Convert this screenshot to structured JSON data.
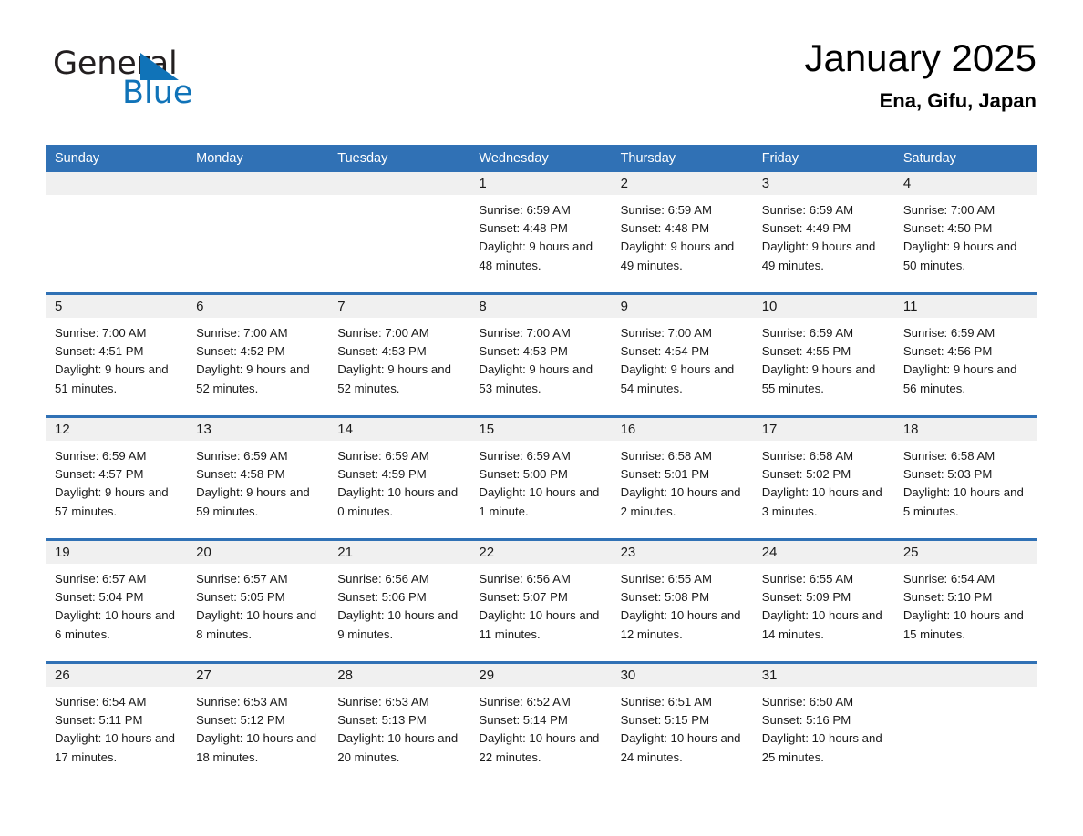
{
  "brand": {
    "name_part1": "General",
    "name_part2": "Blue",
    "triangle_color": "#1073b8",
    "text_color": "#231f20"
  },
  "header": {
    "title": "January 2025",
    "location": "Ena, Gifu, Japan"
  },
  "theme": {
    "header_blue": "#3071b5",
    "daynum_band": "#f0f0f0",
    "page_background": "#ffffff",
    "text": "#1a1a1a"
  },
  "calendar": {
    "weekday_headers": [
      "Sunday",
      "Monday",
      "Tuesday",
      "Wednesday",
      "Thursday",
      "Friday",
      "Saturday"
    ],
    "weeks": [
      [
        {
          "day": "",
          "sunrise": "",
          "sunset": "",
          "daylight": ""
        },
        {
          "day": "",
          "sunrise": "",
          "sunset": "",
          "daylight": ""
        },
        {
          "day": "",
          "sunrise": "",
          "sunset": "",
          "daylight": ""
        },
        {
          "day": "1",
          "sunrise": "Sunrise: 6:59 AM",
          "sunset": "Sunset: 4:48 PM",
          "daylight": "Daylight: 9 hours and 48 minutes."
        },
        {
          "day": "2",
          "sunrise": "Sunrise: 6:59 AM",
          "sunset": "Sunset: 4:48 PM",
          "daylight": "Daylight: 9 hours and 49 minutes."
        },
        {
          "day": "3",
          "sunrise": "Sunrise: 6:59 AM",
          "sunset": "Sunset: 4:49 PM",
          "daylight": "Daylight: 9 hours and 49 minutes."
        },
        {
          "day": "4",
          "sunrise": "Sunrise: 7:00 AM",
          "sunset": "Sunset: 4:50 PM",
          "daylight": "Daylight: 9 hours and 50 minutes."
        }
      ],
      [
        {
          "day": "5",
          "sunrise": "Sunrise: 7:00 AM",
          "sunset": "Sunset: 4:51 PM",
          "daylight": "Daylight: 9 hours and 51 minutes."
        },
        {
          "day": "6",
          "sunrise": "Sunrise: 7:00 AM",
          "sunset": "Sunset: 4:52 PM",
          "daylight": "Daylight: 9 hours and 52 minutes."
        },
        {
          "day": "7",
          "sunrise": "Sunrise: 7:00 AM",
          "sunset": "Sunset: 4:53 PM",
          "daylight": "Daylight: 9 hours and 52 minutes."
        },
        {
          "day": "8",
          "sunrise": "Sunrise: 7:00 AM",
          "sunset": "Sunset: 4:53 PM",
          "daylight": "Daylight: 9 hours and 53 minutes."
        },
        {
          "day": "9",
          "sunrise": "Sunrise: 7:00 AM",
          "sunset": "Sunset: 4:54 PM",
          "daylight": "Daylight: 9 hours and 54 minutes."
        },
        {
          "day": "10",
          "sunrise": "Sunrise: 6:59 AM",
          "sunset": "Sunset: 4:55 PM",
          "daylight": "Daylight: 9 hours and 55 minutes."
        },
        {
          "day": "11",
          "sunrise": "Sunrise: 6:59 AM",
          "sunset": "Sunset: 4:56 PM",
          "daylight": "Daylight: 9 hours and 56 minutes."
        }
      ],
      [
        {
          "day": "12",
          "sunrise": "Sunrise: 6:59 AM",
          "sunset": "Sunset: 4:57 PM",
          "daylight": "Daylight: 9 hours and 57 minutes."
        },
        {
          "day": "13",
          "sunrise": "Sunrise: 6:59 AM",
          "sunset": "Sunset: 4:58 PM",
          "daylight": "Daylight: 9 hours and 59 minutes."
        },
        {
          "day": "14",
          "sunrise": "Sunrise: 6:59 AM",
          "sunset": "Sunset: 4:59 PM",
          "daylight": "Daylight: 10 hours and 0 minutes."
        },
        {
          "day": "15",
          "sunrise": "Sunrise: 6:59 AM",
          "sunset": "Sunset: 5:00 PM",
          "daylight": "Daylight: 10 hours and 1 minute."
        },
        {
          "day": "16",
          "sunrise": "Sunrise: 6:58 AM",
          "sunset": "Sunset: 5:01 PM",
          "daylight": "Daylight: 10 hours and 2 minutes."
        },
        {
          "day": "17",
          "sunrise": "Sunrise: 6:58 AM",
          "sunset": "Sunset: 5:02 PM",
          "daylight": "Daylight: 10 hours and 3 minutes."
        },
        {
          "day": "18",
          "sunrise": "Sunrise: 6:58 AM",
          "sunset": "Sunset: 5:03 PM",
          "daylight": "Daylight: 10 hours and 5 minutes."
        }
      ],
      [
        {
          "day": "19",
          "sunrise": "Sunrise: 6:57 AM",
          "sunset": "Sunset: 5:04 PM",
          "daylight": "Daylight: 10 hours and 6 minutes."
        },
        {
          "day": "20",
          "sunrise": "Sunrise: 6:57 AM",
          "sunset": "Sunset: 5:05 PM",
          "daylight": "Daylight: 10 hours and 8 minutes."
        },
        {
          "day": "21",
          "sunrise": "Sunrise: 6:56 AM",
          "sunset": "Sunset: 5:06 PM",
          "daylight": "Daylight: 10 hours and 9 minutes."
        },
        {
          "day": "22",
          "sunrise": "Sunrise: 6:56 AM",
          "sunset": "Sunset: 5:07 PM",
          "daylight": "Daylight: 10 hours and 11 minutes."
        },
        {
          "day": "23",
          "sunrise": "Sunrise: 6:55 AM",
          "sunset": "Sunset: 5:08 PM",
          "daylight": "Daylight: 10 hours and 12 minutes."
        },
        {
          "day": "24",
          "sunrise": "Sunrise: 6:55 AM",
          "sunset": "Sunset: 5:09 PM",
          "daylight": "Daylight: 10 hours and 14 minutes."
        },
        {
          "day": "25",
          "sunrise": "Sunrise: 6:54 AM",
          "sunset": "Sunset: 5:10 PM",
          "daylight": "Daylight: 10 hours and 15 minutes."
        }
      ],
      [
        {
          "day": "26",
          "sunrise": "Sunrise: 6:54 AM",
          "sunset": "Sunset: 5:11 PM",
          "daylight": "Daylight: 10 hours and 17 minutes."
        },
        {
          "day": "27",
          "sunrise": "Sunrise: 6:53 AM",
          "sunset": "Sunset: 5:12 PM",
          "daylight": "Daylight: 10 hours and 18 minutes."
        },
        {
          "day": "28",
          "sunrise": "Sunrise: 6:53 AM",
          "sunset": "Sunset: 5:13 PM",
          "daylight": "Daylight: 10 hours and 20 minutes."
        },
        {
          "day": "29",
          "sunrise": "Sunrise: 6:52 AM",
          "sunset": "Sunset: 5:14 PM",
          "daylight": "Daylight: 10 hours and 22 minutes."
        },
        {
          "day": "30",
          "sunrise": "Sunrise: 6:51 AM",
          "sunset": "Sunset: 5:15 PM",
          "daylight": "Daylight: 10 hours and 24 minutes."
        },
        {
          "day": "31",
          "sunrise": "Sunrise: 6:50 AM",
          "sunset": "Sunset: 5:16 PM",
          "daylight": "Daylight: 10 hours and 25 minutes."
        },
        {
          "day": "",
          "sunrise": "",
          "sunset": "",
          "daylight": ""
        }
      ]
    ]
  }
}
